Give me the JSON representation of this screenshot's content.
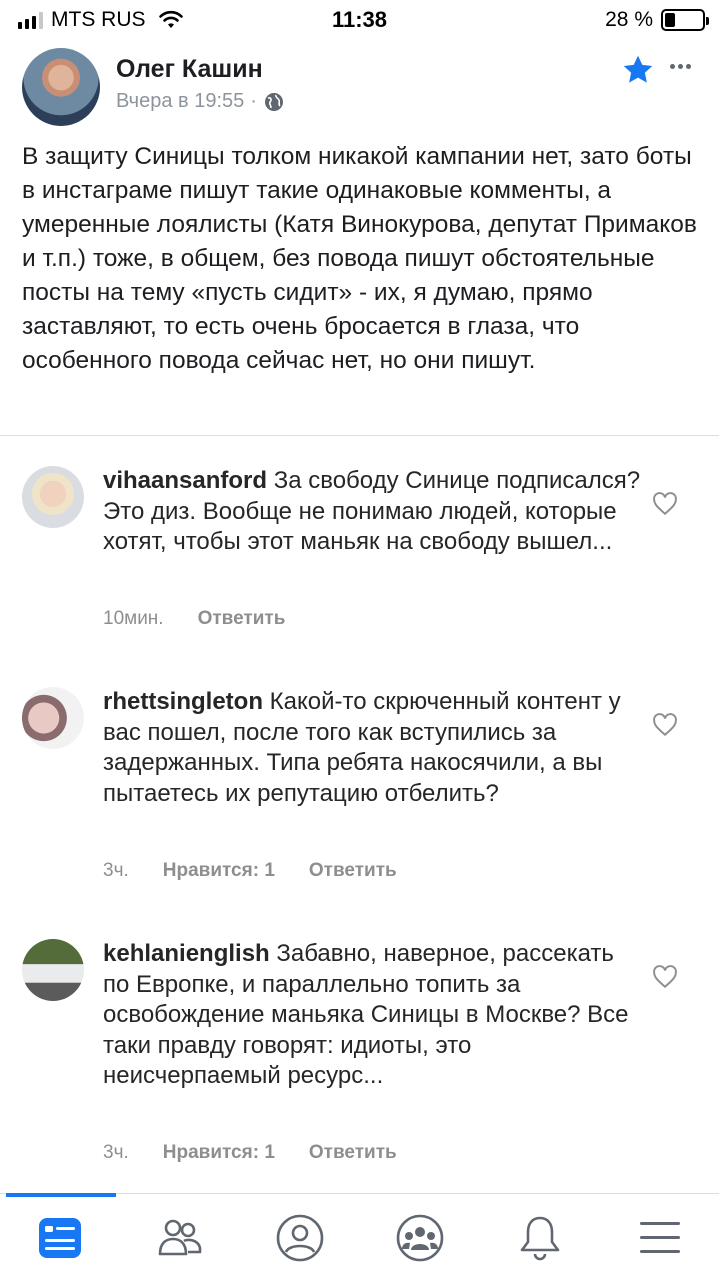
{
  "status_bar": {
    "carrier": "MTS RUS",
    "time": "11:38",
    "battery_percent": "28 %",
    "battery_level": 0.28,
    "signal_bars": 3
  },
  "post": {
    "author": "Олег Кашин",
    "timestamp": "Вчера в 19:55",
    "separator": "·",
    "text": "В защиту Синицы толком никакой кампании нет, зато боты в инстаграме пишут такие одинаковые комменты, а умеренные лоялисты (Катя Винокурова, депутат Примаков и т.п.) тоже, в общем, без повода пишут обстоятельные посты на тему «пусть сидит» - их, я думаю, прямо заставляют, то есть очень бросается в глаза, что особенного повода сейчас нет, но они пишут.",
    "star_color": "#1877f2"
  },
  "comments": [
    {
      "username": "vihaansanford",
      "text": "За свободу Синице подписался? Это диз. Вообще не понимаю людей, которые хотят, чтобы этот маньяк на свободу вышел...",
      "time": "10мин.",
      "likes": "",
      "reply": "Ответить"
    },
    {
      "username": "rhettsingleton",
      "text": "Какой-то скрюченный контент у вас пошел, после того как вступились за задержанных. Типа ребята накосячили, а вы пытаетесь их репутацию отбелить?",
      "time": "3ч.",
      "likes": "Нравится: 1",
      "reply": "Ответить"
    },
    {
      "username": "kehlanienglish",
      "text": "Забавно, наверное, рассекать по Европке, и параллельно топить за освобождение маньяка Синицы в Москве? Все таки правду говорят: идиоты, это неисчерпаемый ресурс...",
      "time": "3ч.",
      "likes": "Нравится: 1",
      "reply": "Ответить"
    }
  ],
  "bottom_nav": {
    "items": [
      {
        "icon": "news-feed-icon",
        "active": true
      },
      {
        "icon": "friends-icon",
        "active": false
      },
      {
        "icon": "profile-icon",
        "active": false
      },
      {
        "icon": "groups-icon",
        "active": false
      },
      {
        "icon": "notifications-bell-icon",
        "active": false
      },
      {
        "icon": "menu-icon",
        "active": false
      }
    ],
    "accent_color": "#1877f2"
  }
}
